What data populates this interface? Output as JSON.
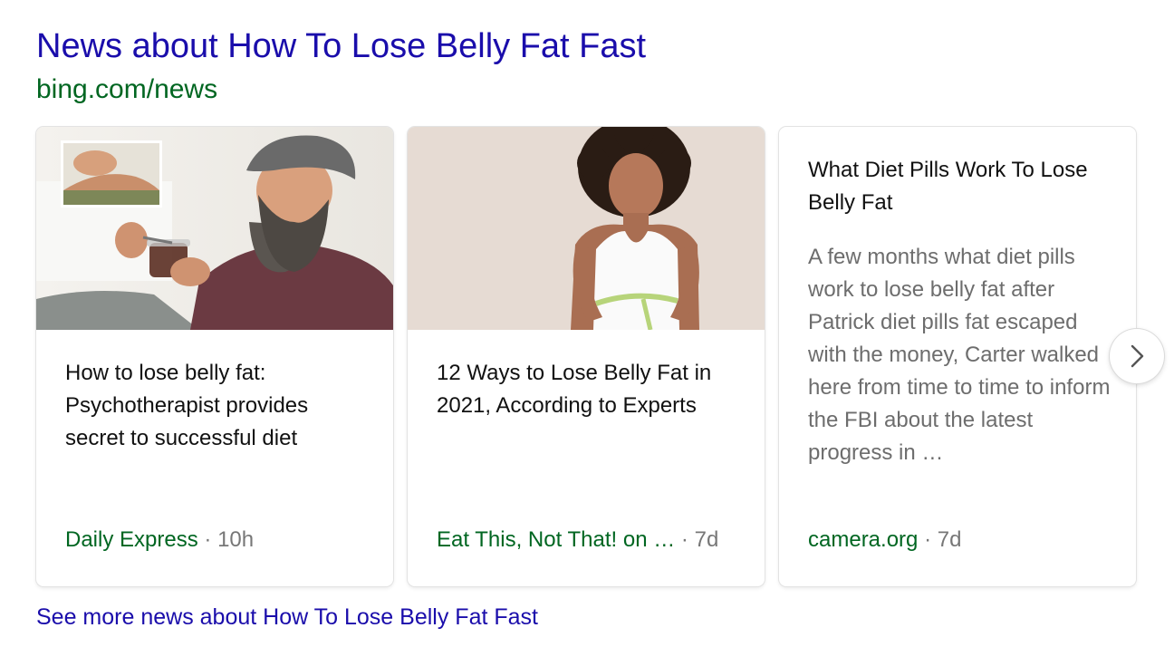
{
  "header": {
    "title": "News about How To Lose Belly Fat Fast",
    "source_url": "bing.com/news"
  },
  "cards": [
    {
      "headline": "How to lose belly fat: Psychotherapist provides secret to successful diet",
      "source": "Daily Express",
      "separator": "·",
      "age": "10h",
      "image": "man-eating-dessert-photo"
    },
    {
      "headline": "12 Ways to Lose Belly Fat in 2021, According to Experts",
      "source": "Eat This, Not That! on …",
      "separator": "·",
      "age": "7d",
      "image": "woman-measuring-waist-photo"
    },
    {
      "headline": "What Diet Pills Work To Lose Belly Fat",
      "snippet": "A few months what diet pills work to lose belly fat after Patrick diet pills fat escaped with the money, Carter walked here from time to time to inform the FBI about the latest progress in …",
      "source": "camera.org",
      "separator": "·",
      "age": "7d"
    }
  ],
  "carousel": {
    "next_icon": "chevron-right-icon"
  },
  "footer": {
    "see_more": "See more news about How To Lose Belly Fat Fast"
  },
  "colors": {
    "link": "#1a0dab",
    "source_green": "#006621",
    "meta_gray": "#777777",
    "snippet_gray": "#6d6d6d"
  }
}
